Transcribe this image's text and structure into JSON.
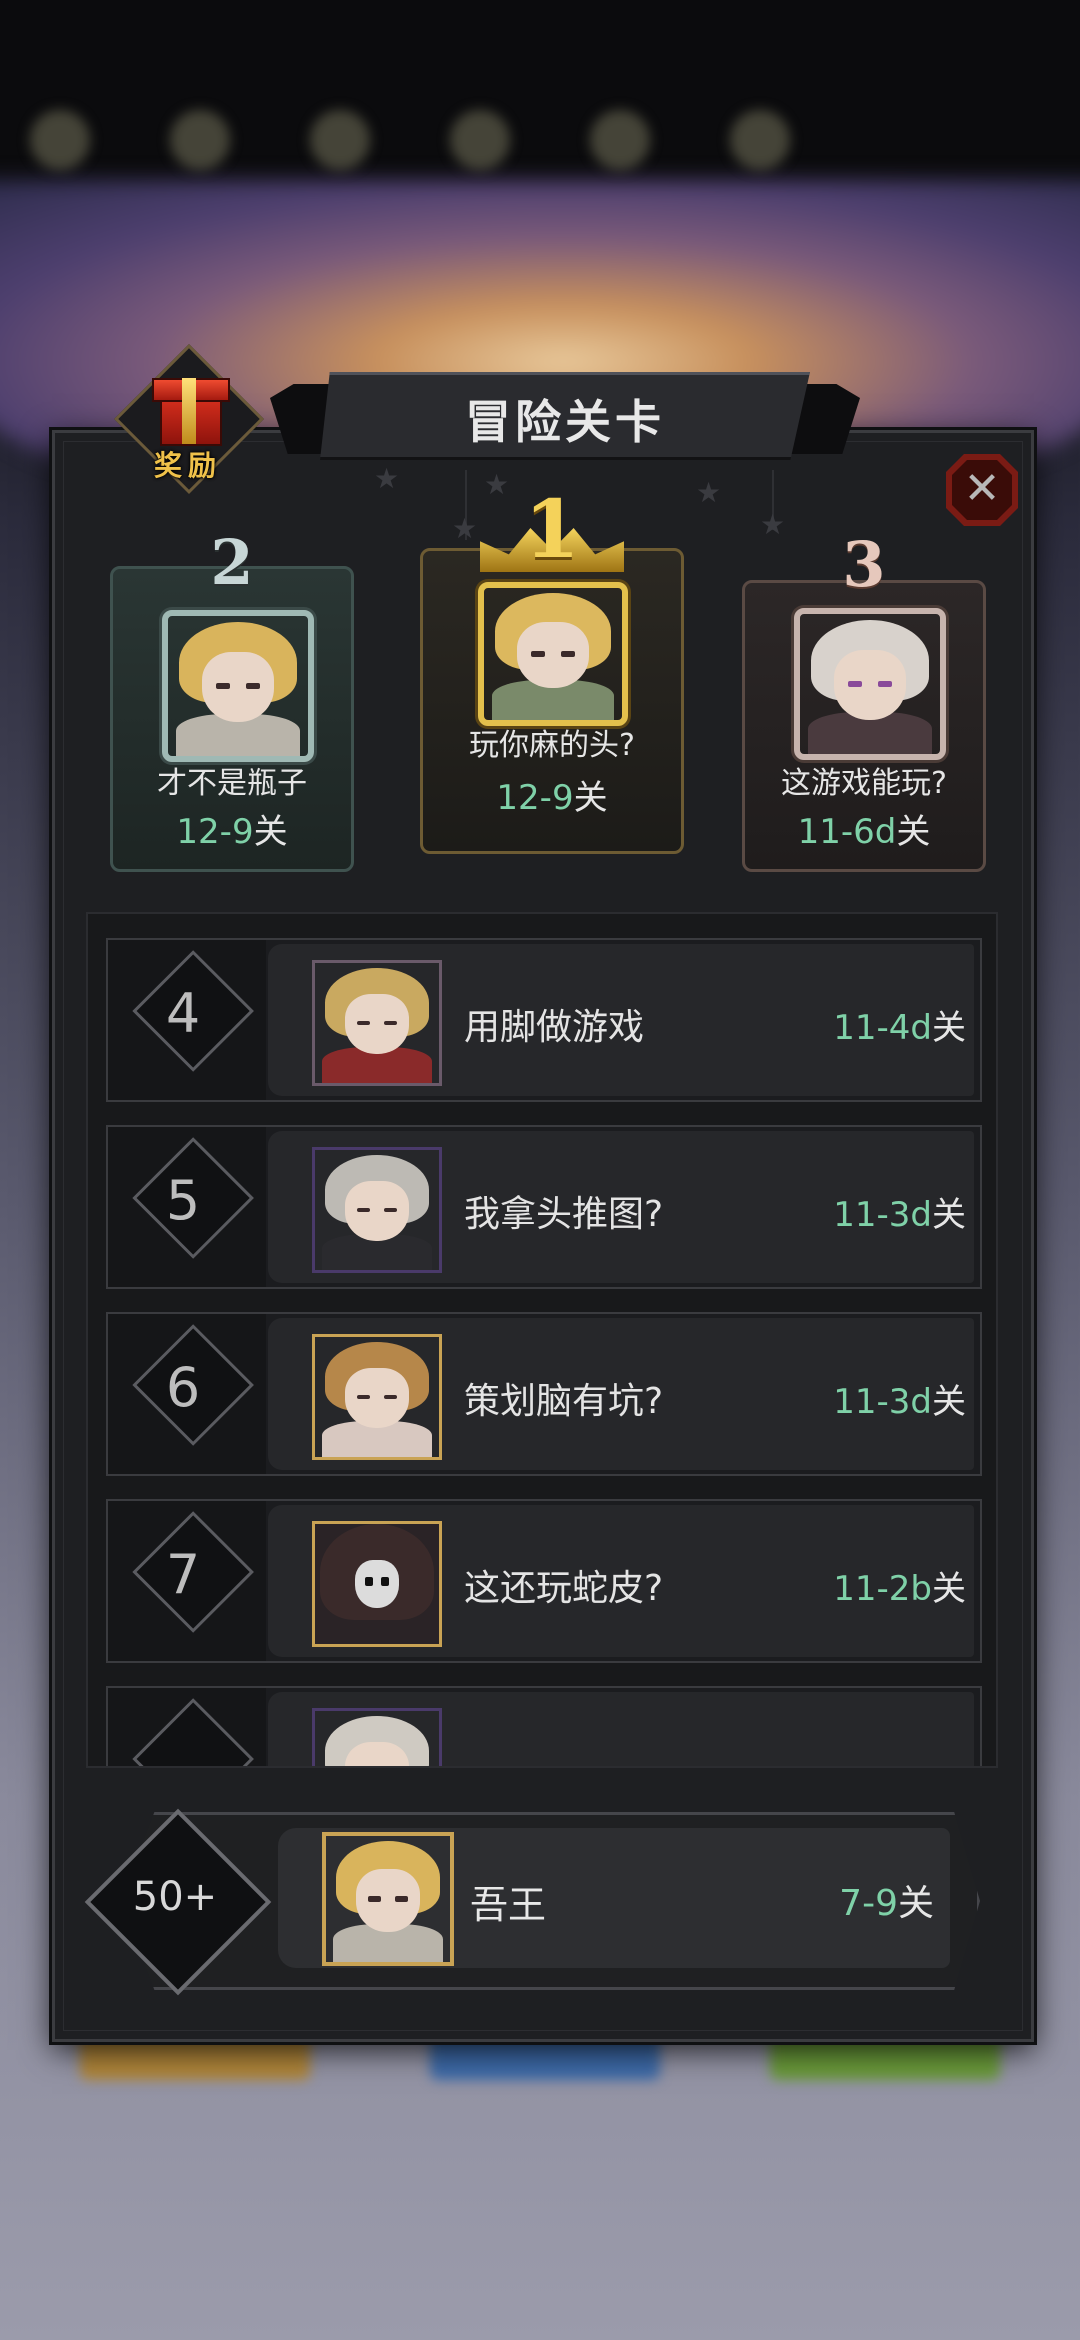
{
  "title": "冒险关卡",
  "reward_label": "奖励",
  "podium": [
    {
      "rank": "2",
      "name": "才不是瓶子",
      "level": "12-9",
      "unit": "关"
    },
    {
      "rank": "1",
      "name": "玩你麻的头?",
      "level": "12-9",
      "unit": "关"
    },
    {
      "rank": "3",
      "name": "这游戏能玩?",
      "level": "11-6d",
      "unit": "关"
    }
  ],
  "rows": [
    {
      "rank": "4",
      "name": "用脚做游戏",
      "level": "11-4d",
      "unit": "关"
    },
    {
      "rank": "5",
      "name": "我拿头推图?",
      "level": "11-3d",
      "unit": "关"
    },
    {
      "rank": "6",
      "name": "策划脑有坑?",
      "level": "11-3d",
      "unit": "关"
    },
    {
      "rank": "7",
      "name": "这还玩蛇皮?",
      "level": "11-2b",
      "unit": "关"
    }
  ],
  "self": {
    "rank": "50+",
    "name": "吾王",
    "level": "7-9",
    "unit": "关"
  },
  "colors": {
    "level_green": "#7fd1a8",
    "gold": "#e3c04c",
    "close_red": "#7a1b14"
  },
  "icons": {
    "close": "close-icon",
    "gift": "gift-icon",
    "star": "star-icon"
  }
}
